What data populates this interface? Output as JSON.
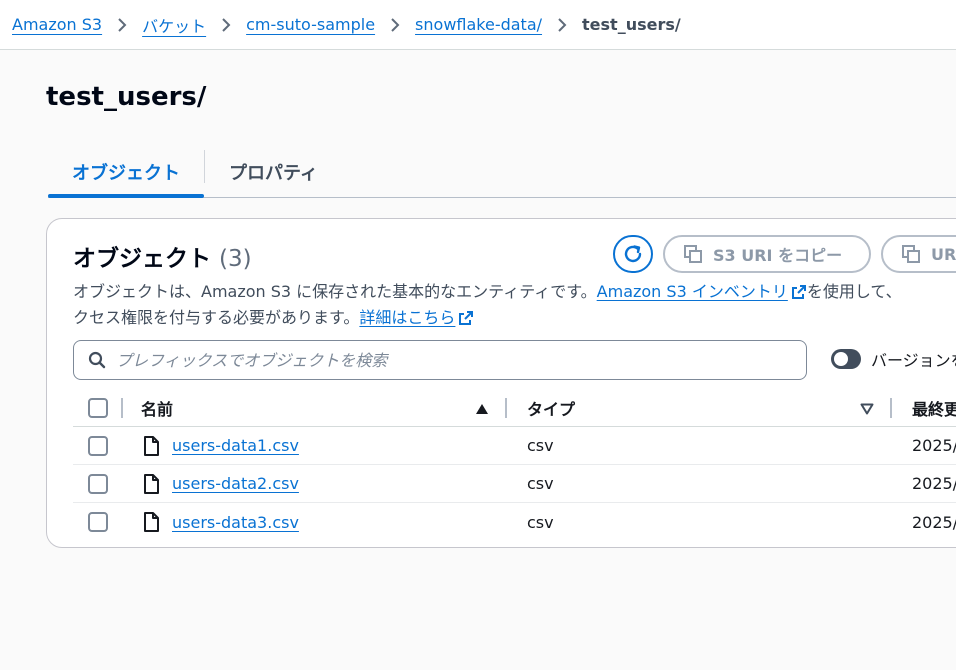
{
  "breadcrumb": {
    "items": [
      "Amazon S3",
      "バケット",
      "cm-suto-sample",
      "snowflake-data/"
    ],
    "current": "test_users/"
  },
  "page": {
    "title": "test_users/"
  },
  "tabs": [
    {
      "label": "オブジェクト",
      "active": true
    },
    {
      "label": "プロパティ",
      "active": false
    }
  ],
  "objects_panel": {
    "title": "オブジェクト",
    "count": "(3)",
    "copy_s3_uri_label": "S3 URI をコピー",
    "copy_url_label": "URL",
    "description_line1_a": "オブジェクトは、Amazon S3 に保存された基本的なエンティティです。",
    "inventory_link": "Amazon S3 インベントリ",
    "description_line1_b": "を使用して、",
    "description_line2_a": "クセス権限を付与する必要があります。",
    "details_link": "詳細はこちら",
    "search_placeholder": "プレフィックスでオブジェクトを検索",
    "versions_label": "バージョンを表示"
  },
  "table": {
    "columns": {
      "name": "名前",
      "type": "タイプ",
      "modified": "最終更新日時"
    },
    "rows": [
      {
        "name": "users-data1.csv",
        "type": "csv",
        "modified": "2025/"
      },
      {
        "name": "users-data2.csv",
        "type": "csv",
        "modified": "2025/"
      },
      {
        "name": "users-data3.csv",
        "type": "csv",
        "modified": "2025/"
      }
    ]
  },
  "colors": {
    "link": "#0972d3",
    "text": "#16191f",
    "border": "#b6bec9"
  },
  "icons": [
    "chevron-right-icon",
    "refresh-icon",
    "copy-icon",
    "external-link-icon",
    "search-icon",
    "file-icon",
    "sort-ascending-icon",
    "sort-descending-icon"
  ]
}
